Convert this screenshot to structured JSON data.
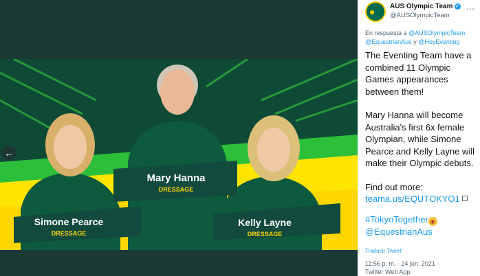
{
  "media": {
    "athletes": [
      {
        "name": "Simone Pearce",
        "discipline": "DRESSAGE"
      },
      {
        "name": "Mary Hanna",
        "discipline": "DRESSAGE"
      },
      {
        "name": "Kelly Layne",
        "discipline": "DRESSAGE"
      }
    ],
    "colors": {
      "green": "#00843d",
      "yellow": "#ffd600",
      "dark_green": "#0f4a37",
      "backdrop": "#1b3a36"
    },
    "prev_icon": "arrow-left-icon"
  },
  "tweet": {
    "account_name": "AUS Olympic Team",
    "account_handle": "@AUSOlympicTeam",
    "reply_prefix": "En respuesta a",
    "reply_handles": [
      "@AUSOlympicTeam",
      "@EquestrianAus",
      "@HoyEventing"
    ],
    "reply_conjunction": "y",
    "paragraph1": "The Eventing Team have a combined 11 Olympic Games appearances between them!",
    "paragraph2": "Mary Hanna will become Australia's first 6x female Olympian, while Simone Pearce and Kelly Layne will make their Olympic debuts.",
    "find_out": "Find out more:",
    "link": "teama.us/EQUTOKYO1",
    "hashtag": "#TokyoTogether",
    "mention": "@EquestrianAus",
    "translate": "Traducir Tweet",
    "time": "11:56 p. m. · 24 jun. 2021 ·",
    "source": "Twitter Web App"
  }
}
